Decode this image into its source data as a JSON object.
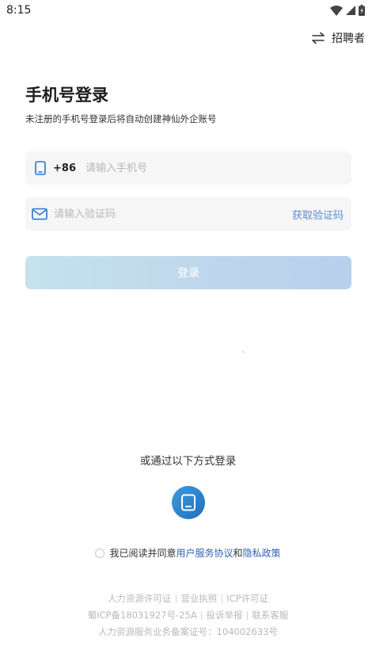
{
  "status_bar": {
    "time": "8:15"
  },
  "header": {
    "switch_label": "招聘者"
  },
  "login": {
    "title": "手机号登录",
    "subtitle": "未注册的手机号登录后将自动创建神仙外企账号",
    "country_code": "+86",
    "phone_placeholder": "请输入手机号",
    "code_placeholder": "请输入验证码",
    "get_code_label": "获取验证码",
    "submit_label": "登录"
  },
  "alternative": {
    "title": "或通过以下方式登录",
    "method_icon": "tablet-icon"
  },
  "agreement": {
    "prefix": "我已阅读并同意",
    "user_agreement": "用户服务协议",
    "connector": "和",
    "privacy_policy": "隐私政策"
  },
  "footer": {
    "line1": [
      "人力资源许可证",
      "营业执照",
      "ICP许可证"
    ],
    "line2": [
      "蜀ICP备18031927号-25A",
      "投诉举报",
      "联系客服"
    ],
    "line3": "人力资源服务业务备案证号：104002633号"
  },
  "colors": {
    "accent": "#2f63b5",
    "link": "#5b8bd0",
    "button_gradient_start": "#c5e2ee",
    "button_gradient_end": "#b8d0ec",
    "alt_icon_bg": "#2b7fcc"
  }
}
